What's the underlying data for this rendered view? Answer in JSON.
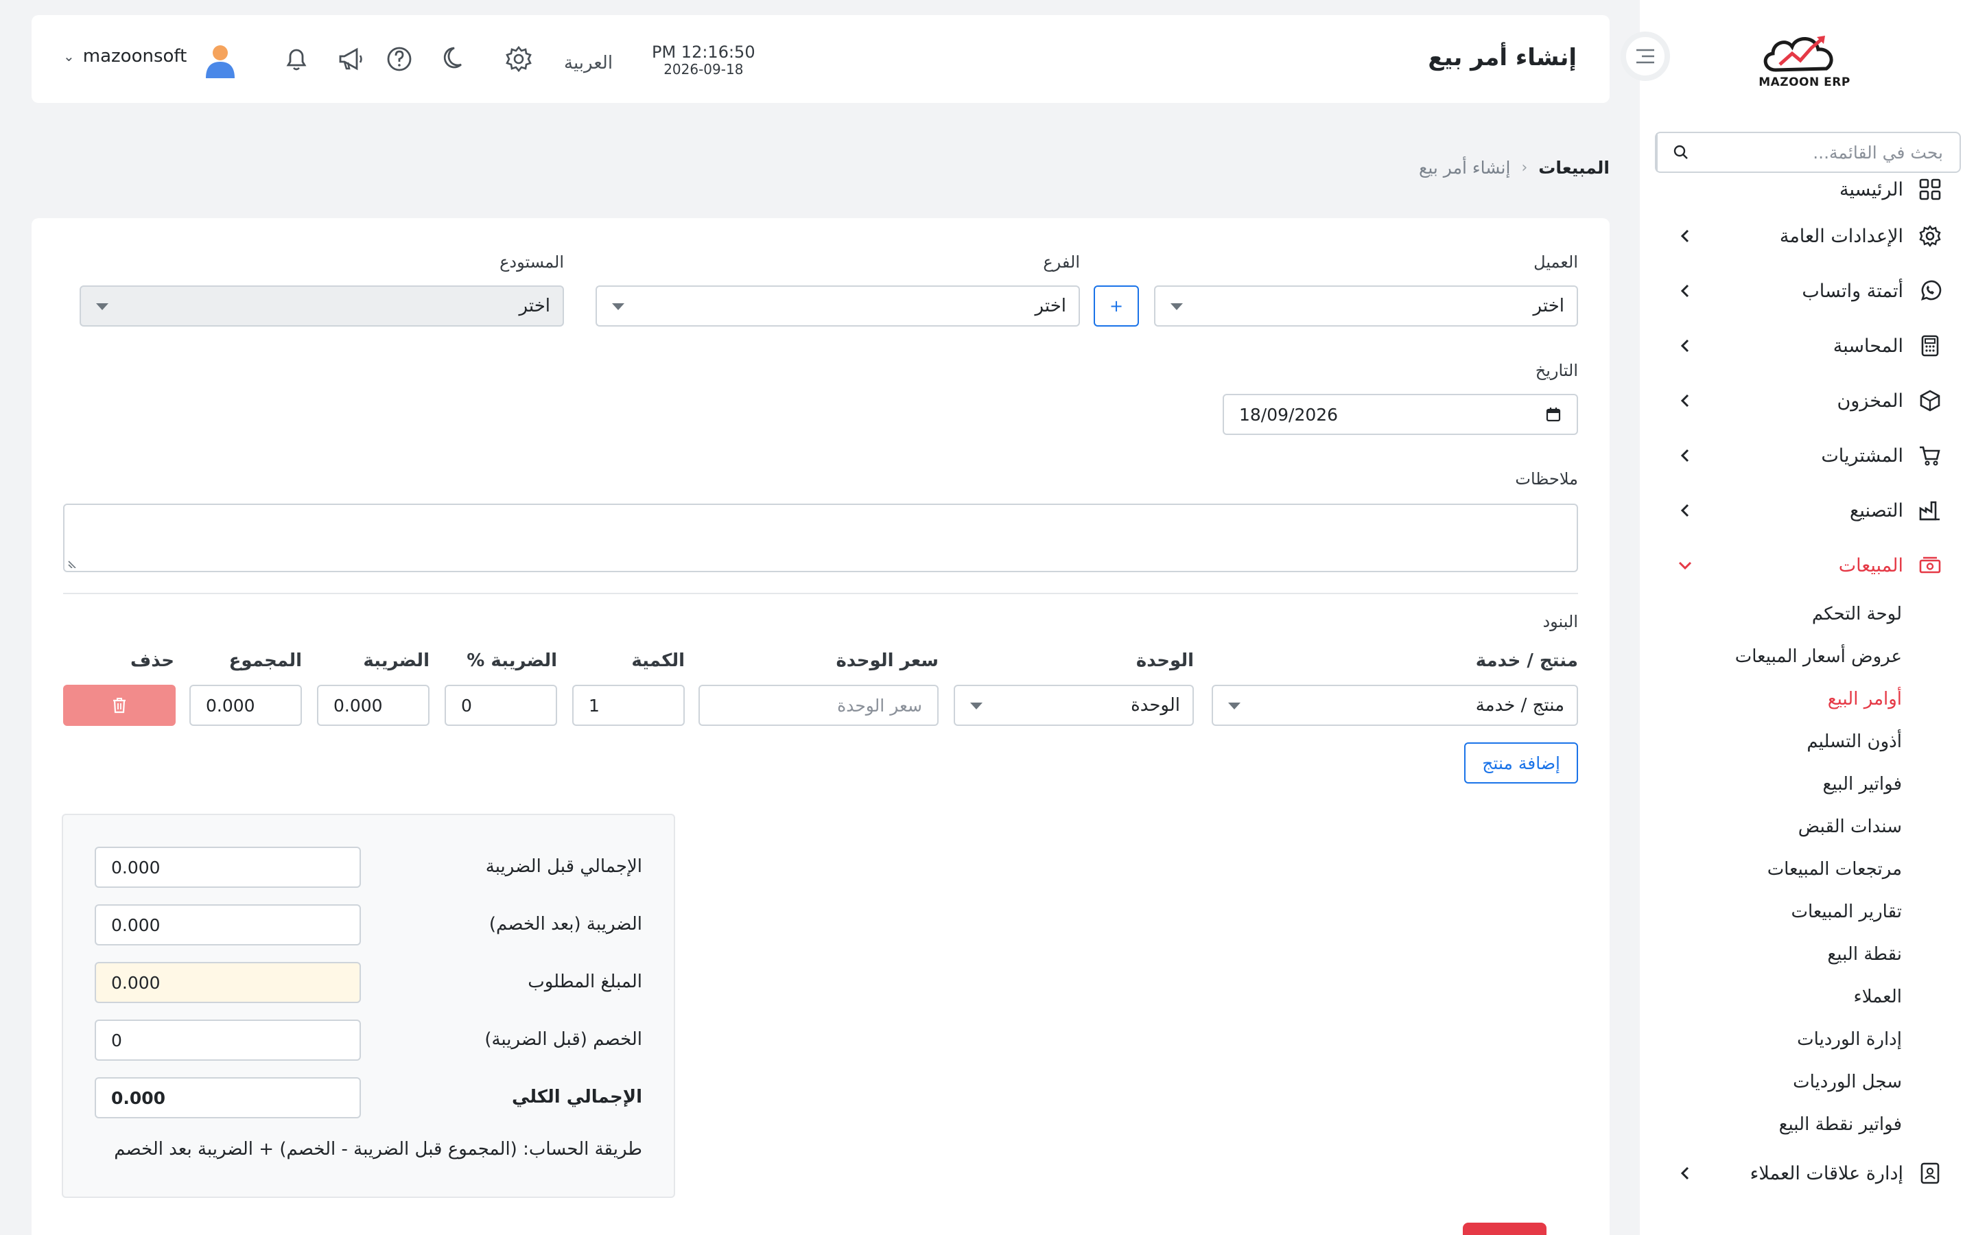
{
  "sidebar": {
    "logo_text": "MAZOON ERP",
    "search_placeholder": "بحث في القائمة...",
    "nav": [
      {
        "label": "الرئيسية",
        "icon": "grid-icon"
      },
      {
        "label": "الإعدادات العامة",
        "icon": "gear-icon"
      },
      {
        "label": "أتمتة واتساب",
        "icon": "whatsapp-icon"
      },
      {
        "label": "المحاسبة",
        "icon": "calculator-icon"
      },
      {
        "label": "المخزون",
        "icon": "box-icon"
      },
      {
        "label": "المشتريات",
        "icon": "cart-icon"
      },
      {
        "label": "التصنيع",
        "icon": "factory-icon"
      },
      {
        "label": "المبيعات",
        "icon": "cash-icon"
      }
    ],
    "sales_sub": [
      "لوحة التحكم",
      "عروض أسعار المبيعات",
      "أوامر البيع",
      "أذون التسليم",
      "فواتير البيع",
      "سندات القبض",
      "مرتجعات المبيعات",
      "تقارير المبيعات",
      "نقطة البيع",
      "العملاء",
      "إدارة الورديات",
      "سجل الورديات",
      "فواتير نقطة البيع"
    ],
    "crm": "إدارة علاقات العملاء"
  },
  "header": {
    "page_title": "إنشاء أمر بيع",
    "time": "PM 12:16:50",
    "date": "2026-09-18",
    "language": "العربية",
    "username": "mazoonsoft"
  },
  "breadcrumb": {
    "home": "المبيعات",
    "separator": "‹",
    "current": "إنشاء أمر بيع"
  },
  "form": {
    "customer_label": "العميل",
    "customer_value": "اختر",
    "add_button": "+",
    "branch_label": "الفرع",
    "branch_value": "اختر",
    "warehouse_label": "المستودع",
    "warehouse_value": "اختر",
    "date_label": "التاريخ",
    "date_value": "18/09/2026",
    "notes_label": "ملاحظات",
    "items_label": "البنود"
  },
  "items": {
    "headers": {
      "product": "منتج / خدمة",
      "unit": "الوحدة",
      "unit_price": "سعر الوحدة",
      "qty": "الكمية",
      "tax_pct": "الضريبة %",
      "tax": "الضريبة",
      "total": "المجموع",
      "delete": "حذف"
    },
    "row": {
      "product": "منتج / خدمة",
      "unit": "الوحدة",
      "unit_price_placeholder": "سعر الوحدة",
      "qty": "1",
      "tax_pct": "0",
      "tax": "0.000",
      "total": "0.000"
    },
    "add_product": "إضافة منتج"
  },
  "summary": {
    "subtotal_label": "الإجمالي قبل الضريبة",
    "subtotal": "0.000",
    "tax_label": "الضريبة (بعد الخصم)",
    "tax": "0.000",
    "due_label": "المبلغ المطلوب",
    "due": "0.000",
    "discount_label": "الخصم (قبل الضريبة)",
    "discount": "0",
    "grand_label": "الإجمالي الكلي",
    "grand": "0.000",
    "formula": "طريقة الحساب: (المجموع قبل الضريبة - الخصم) + الضريبة بعد الخصم"
  },
  "colors": {
    "accent_red": "#e53946",
    "primary_blue": "#1a73e8",
    "delete_red": "#f28b8b"
  }
}
